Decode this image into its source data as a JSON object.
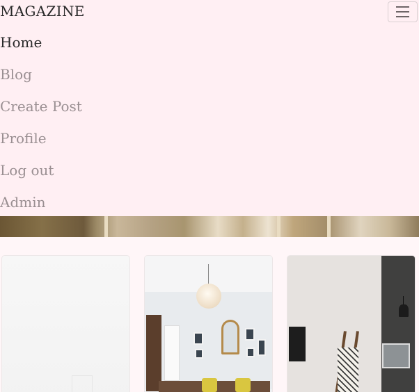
{
  "navbar": {
    "brand": "MAGAZINE",
    "toggler_icon": "hamburger-menu-icon",
    "items": [
      {
        "label": "Home",
        "active": true
      },
      {
        "label": "Blog",
        "active": false
      },
      {
        "label": "Create Post",
        "active": false
      },
      {
        "label": "Profile",
        "active": false
      },
      {
        "label": "Log out",
        "active": false
      },
      {
        "label": "Admin",
        "active": false
      }
    ]
  },
  "colors": {
    "nav_background": "#ffeff3",
    "page_background": "#fff6f8",
    "active_text": "#2a2a2a",
    "inactive_text": "#9a8f92"
  }
}
